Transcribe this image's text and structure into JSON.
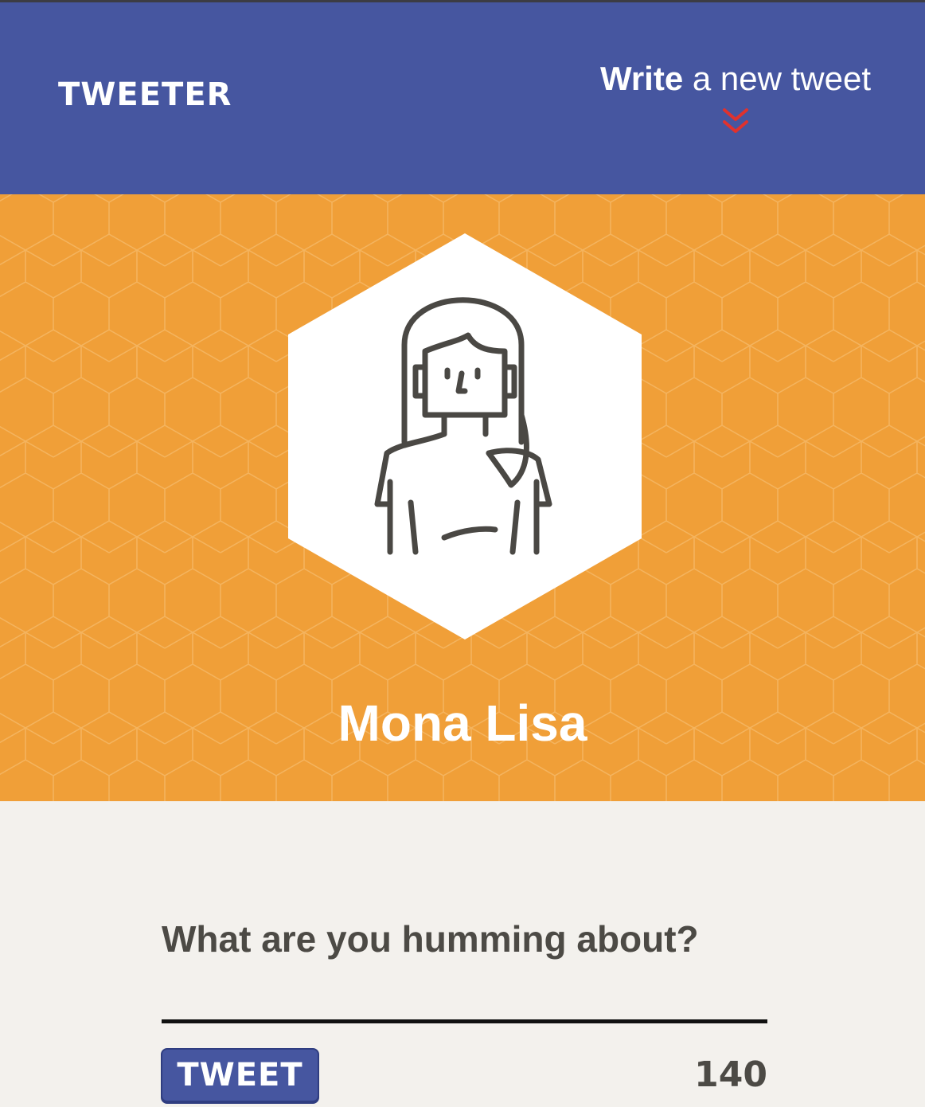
{
  "header": {
    "brand": "TWEETER",
    "compose_strong": "Write",
    "compose_rest": "a new tweet",
    "compose_icon": "double-chevron-down-icon"
  },
  "profile": {
    "name": "Mona Lisa",
    "avatar_icon": "woman-avatar-icon"
  },
  "composer": {
    "label": "What are you humming about?",
    "input_value": "",
    "button_label": "TWEET",
    "counter": "140"
  },
  "colors": {
    "nav_background": "#4656a0",
    "profile_background": "#f09f38",
    "chevron_accent": "#e0322e",
    "page_background": "#f3f1ed",
    "text_dark": "#4c4a45"
  }
}
